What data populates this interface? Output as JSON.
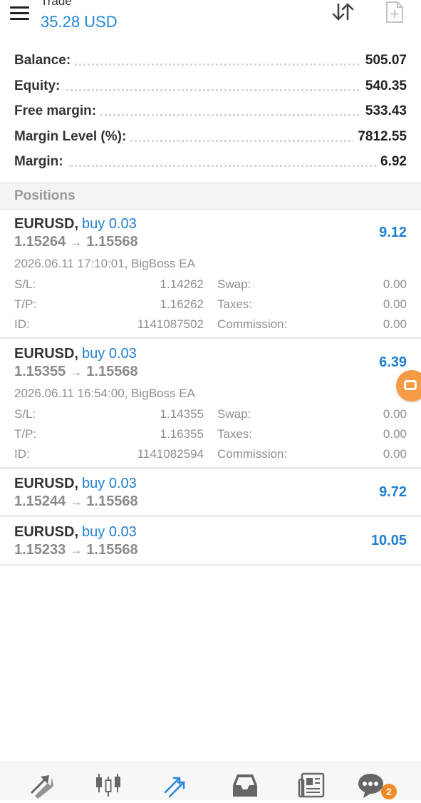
{
  "header": {
    "title": "Trade",
    "subtitle": "35.28 USD"
  },
  "icons": {
    "menu": "hamburger-icon",
    "sort": "sort-arrows-icon",
    "new_order": "new-order-icon"
  },
  "summary": [
    {
      "label": "Balance:",
      "value": "505.07"
    },
    {
      "label": "Equity:",
      "value": "540.35"
    },
    {
      "label": "Free margin:",
      "value": "533.43"
    },
    {
      "label": "Margin Level (%):",
      "value": "7812.55"
    },
    {
      "label": "Margin:",
      "value": "6.92"
    }
  ],
  "section_label": "Positions",
  "positions": [
    {
      "symbol": "EURUSD,",
      "side": "buy 0.03",
      "open_price": "1.15264",
      "arrow": "→",
      "current_price": "1.15568",
      "profit": "9.12",
      "meta": "2026.06.11 17:10:01, BigBoss EA",
      "sl_label": "S/L:",
      "sl": "1.14262",
      "tp_label": "T/P:",
      "tp": "1.16262",
      "id_label": "ID:",
      "id": "1141087502",
      "swap_label": "Swap:",
      "swap": "0.00",
      "taxes_label": "Taxes:",
      "taxes": "0.00",
      "commission_label": "Commission:",
      "commission": "0.00"
    },
    {
      "symbol": "EURUSD,",
      "side": "buy 0.03",
      "open_price": "1.15355",
      "arrow": "→",
      "current_price": "1.15568",
      "profit": "6.39",
      "meta": "2026.06.11 16:54:00, BigBoss EA",
      "sl_label": "S/L:",
      "sl": "1.14355",
      "tp_label": "T/P:",
      "tp": "1.16355",
      "id_label": "ID:",
      "id": "1141082594",
      "swap_label": "Swap:",
      "swap": "0.00",
      "taxes_label": "Taxes:",
      "taxes": "0.00",
      "commission_label": "Commission:",
      "commission": "0.00"
    },
    {
      "symbol": "EURUSD,",
      "side": "buy 0.03",
      "open_price": "1.15244",
      "arrow": "→",
      "current_price": "1.15568",
      "profit": "9.72"
    },
    {
      "symbol": "EURUSD,",
      "side": "buy 0.03",
      "open_price": "1.15233",
      "arrow": "→",
      "current_price": "1.15568",
      "profit": "10.05"
    }
  ],
  "bottom_nav": [
    {
      "icon": "quotes-icon"
    },
    {
      "icon": "chart-candles-icon"
    },
    {
      "icon": "trade-icon",
      "active": true
    },
    {
      "icon": "history-inbox-icon"
    },
    {
      "icon": "news-icon"
    },
    {
      "icon": "messages-icon",
      "badge": "2"
    }
  ],
  "colors": {
    "accent": "#1e7fd1",
    "badge": "#f08a24"
  }
}
